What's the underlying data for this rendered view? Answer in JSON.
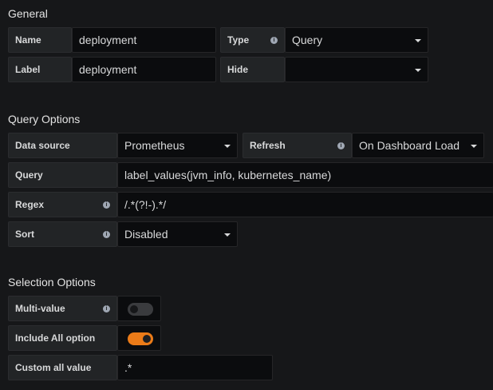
{
  "general": {
    "title": "General",
    "name_label": "Name",
    "name_value": "deployment",
    "type_label": "Type",
    "type_value": "Query",
    "label_label": "Label",
    "label_value": "deployment",
    "hide_label": "Hide",
    "hide_value": ""
  },
  "query_options": {
    "title": "Query Options",
    "datasource_label": "Data source",
    "datasource_value": "Prometheus",
    "refresh_label": "Refresh",
    "refresh_value": "On Dashboard Load",
    "query_label": "Query",
    "query_value": "label_values(jvm_info, kubernetes_name)",
    "regex_label": "Regex",
    "regex_value": "/.*(?!-).*/",
    "sort_label": "Sort",
    "sort_value": "Disabled"
  },
  "selection_options": {
    "title": "Selection Options",
    "multi_value_label": "Multi-value",
    "multi_value_on": false,
    "include_all_label": "Include All option",
    "include_all_on": true,
    "custom_all_label": "Custom all value",
    "custom_all_value": ".*"
  },
  "colors": {
    "background": "#161719",
    "toggle_on": "#eb7b18",
    "toggle_off": "#3a3b3e"
  }
}
